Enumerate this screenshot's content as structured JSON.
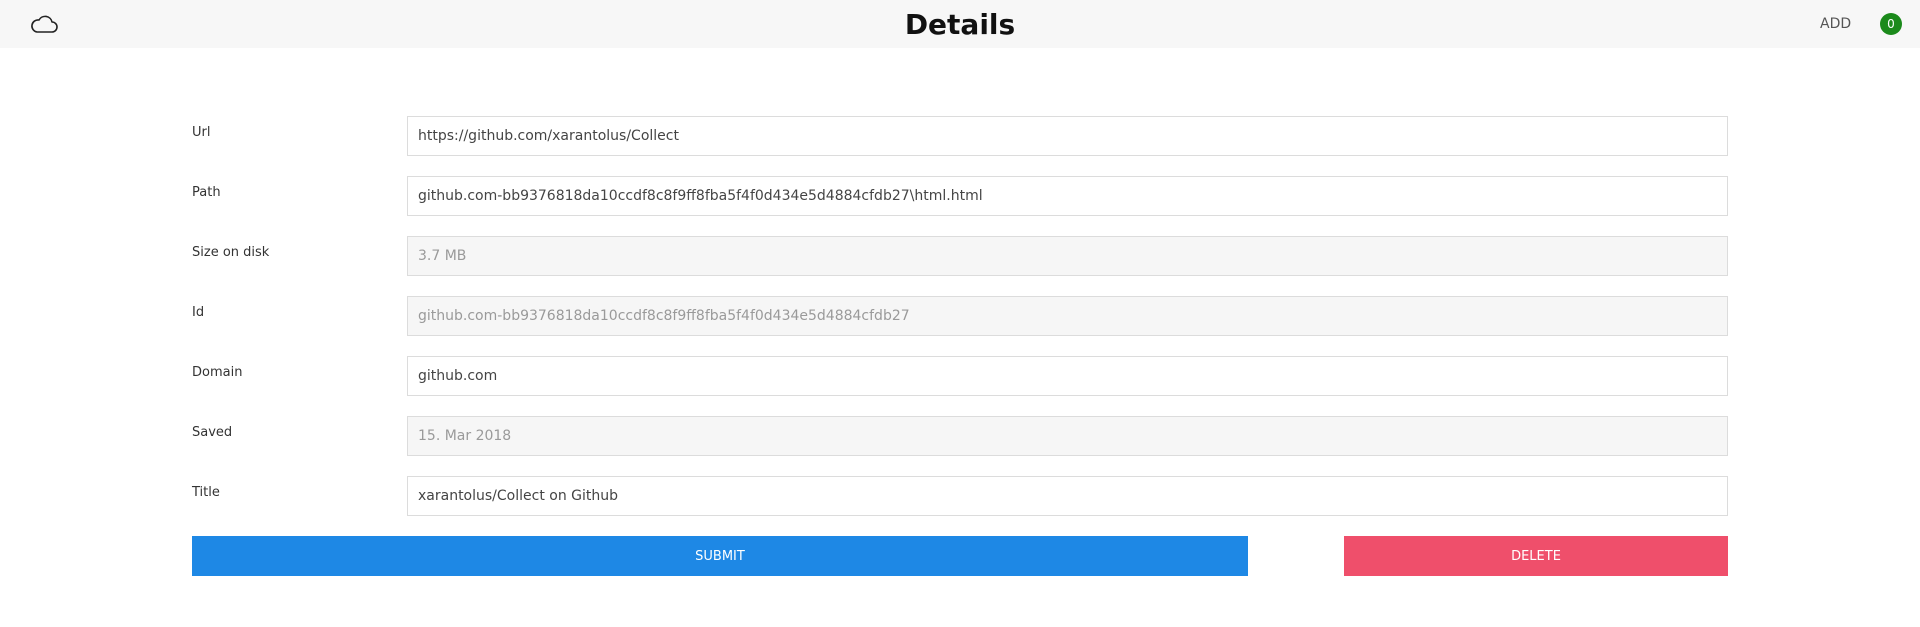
{
  "header": {
    "title": "Details",
    "logo_icon": "cloud-icon",
    "add_label": "ADD",
    "count": "0",
    "badge_color": "#1b8a1b"
  },
  "fields": [
    {
      "label": "Url",
      "value": "https://github.com/xarantolus/Collect",
      "readonly": false
    },
    {
      "label": "Path",
      "value": "github.com-bb9376818da10ccdf8c8f9ff8fba5f4f0d434e5d4884cfdb27\\html.html",
      "readonly": false
    },
    {
      "label": "Size on disk",
      "value": "3.7 MB",
      "readonly": true
    },
    {
      "label": "Id",
      "value": "github.com-bb9376818da10ccdf8c8f9ff8fba5f4f0d434e5d4884cfdb27",
      "readonly": true
    },
    {
      "label": "Domain",
      "value": "github.com",
      "readonly": false
    },
    {
      "label": "Saved",
      "value": "15. Mar 2018",
      "readonly": true
    },
    {
      "label": "Title",
      "value": "xarantolus/Collect on Github",
      "readonly": false
    }
  ],
  "actions": {
    "submit_label": "SUBMIT",
    "delete_label": "DELETE",
    "submit_color": "#1e88e5",
    "delete_color": "#ef4f6b"
  }
}
